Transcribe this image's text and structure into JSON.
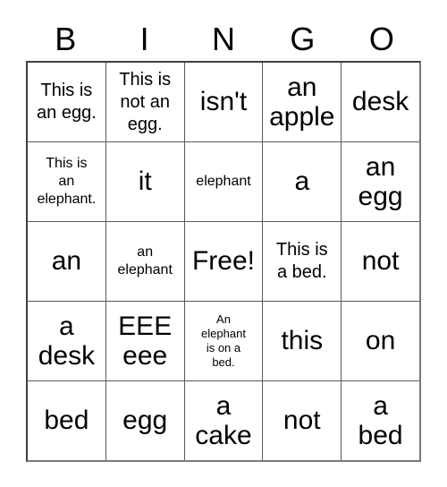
{
  "card": {
    "header": {
      "letters": [
        "B",
        "I",
        "N",
        "G",
        "O"
      ]
    },
    "rows": [
      {
        "cells": [
          {
            "text": "This is\nan egg.",
            "size": "size-md"
          },
          {
            "text": "This is\nnot an\negg.",
            "size": "size-md"
          },
          {
            "text": "isn't",
            "size": "size-xl"
          },
          {
            "text": "an\napple",
            "size": "size-lg"
          },
          {
            "text": "desk",
            "size": "size-xl"
          }
        ]
      },
      {
        "cells": [
          {
            "text": "This is\nan\nelephant.",
            "size": "size-sm"
          },
          {
            "text": "it",
            "size": "size-xl"
          },
          {
            "text": "elephant",
            "size": "size-sm"
          },
          {
            "text": "a",
            "size": "size-xl"
          },
          {
            "text": "an\negg",
            "size": "size-lg"
          }
        ]
      },
      {
        "cells": [
          {
            "text": "an",
            "size": "size-xl"
          },
          {
            "text": "an\nelephant",
            "size": "size-sm"
          },
          {
            "text": "Free!",
            "size": "size-xl"
          },
          {
            "text": "This is\na bed.",
            "size": "size-md"
          },
          {
            "text": "not",
            "size": "size-xl"
          }
        ]
      },
      {
        "cells": [
          {
            "text": "a\ndesk",
            "size": "size-lg"
          },
          {
            "text": "EEE\neee",
            "size": "size-lg"
          },
          {
            "text": "An\nelephant\nis on a\nbed.",
            "size": "size-xs"
          },
          {
            "text": "this",
            "size": "size-xl"
          },
          {
            "text": "on",
            "size": "size-xl"
          }
        ]
      },
      {
        "cells": [
          {
            "text": "bed",
            "size": "size-xl"
          },
          {
            "text": "egg",
            "size": "size-xl"
          },
          {
            "text": "a\ncake",
            "size": "size-lg"
          },
          {
            "text": "not",
            "size": "size-xl"
          },
          {
            "text": "a\nbed",
            "size": "size-lg"
          }
        ]
      }
    ]
  },
  "colors": {
    "background": "#ffffff",
    "text": "#000000",
    "grid_line": "#5a5a5a",
    "outer_border": "#3f3f3f"
  }
}
